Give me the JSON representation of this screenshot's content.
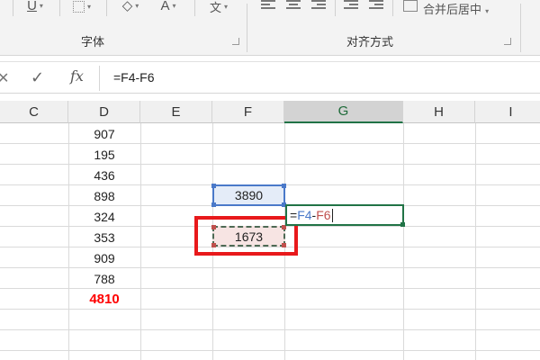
{
  "ribbon": {
    "underline_label": "U",
    "font_color_label": "A",
    "phonetic_label": "文",
    "group_font_label": "字体",
    "group_align_label": "对齐方式",
    "merge_center_label": "合并后居中",
    "dropdown_caret": "▾",
    "launcher_icon": "dialog-launcher-icon"
  },
  "formula_bar": {
    "cancel_glyph": "✕",
    "enter_glyph": "✓",
    "fx_label": "fx",
    "formula": "=F4-F6"
  },
  "columns": [
    "C",
    "D",
    "E",
    "F",
    "G",
    "H",
    "I"
  ],
  "active_column": "G",
  "column_d_values": [
    "907",
    "195",
    "436",
    "898",
    "324",
    "353",
    "909",
    "788"
  ],
  "column_d_total": "4810",
  "f4_value": "3890",
  "f6_value": "1673",
  "g5_edit": {
    "eq": "=",
    "ref1": "F4",
    "op": "-",
    "ref2": "F6"
  },
  "colors": {
    "total_text": "#ff0000",
    "ref1_color": "#4a79c9",
    "ref2_color": "#c0504d",
    "highlight_box": "#e8191b",
    "excel_green": "#217346"
  }
}
